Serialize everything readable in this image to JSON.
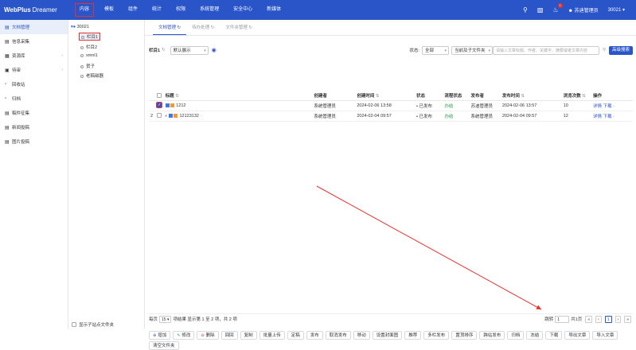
{
  "topbar": {
    "logo": "WebPlus",
    "logo_sub": "Dreamer",
    "nav": [
      "内容",
      "模板",
      "组件",
      "统计",
      "权限",
      "系统管理",
      "安全中心",
      "新媒体"
    ],
    "badge_count": "1",
    "user": "苏迪管理员",
    "site": "30021",
    "colors": {
      "bar": "#2a55c9",
      "highlight": "#e8312c"
    }
  },
  "sidebar": {
    "items": [
      {
        "label": "文档管理",
        "icon": "document-icon"
      },
      {
        "label": "信息采集",
        "icon": "collect-icon"
      },
      {
        "label": "资源库",
        "icon": "database-icon"
      },
      {
        "label": "待审",
        "icon": "review-icon"
      },
      {
        "label": "回收站",
        "icon": "trash-icon"
      },
      {
        "label": "归档",
        "icon": "archive-icon"
      },
      {
        "label": "稿件征集",
        "icon": "manuscript-icon"
      },
      {
        "label": "新闻投稿",
        "icon": "news-icon"
      },
      {
        "label": "图片投稿",
        "icon": "image-icon"
      }
    ]
  },
  "tree": {
    "root": "30021",
    "nodes": [
      "栏目1",
      "栏目2",
      "xmnl1",
      "贺子",
      "老稿磁器"
    ],
    "footer": "显示子站点文件夹"
  },
  "tabs": [
    "文档管理",
    "待办处理",
    "文件夹管理"
  ],
  "filter": {
    "column": "栏目1",
    "view": "默认展示",
    "status_label": "状态:",
    "status": "全部",
    "scope": "当前及子文件夹",
    "search_placeholder": "请输入文章标题、作者、关键字、摘要或者文章内容",
    "advanced": "高级搜索"
  },
  "table": {
    "headers": [
      "标题",
      "创建者",
      "创建时间",
      "状态",
      "流程状态",
      "发布者",
      "发布时间",
      "浏览次数",
      "操作"
    ],
    "rows": [
      {
        "no": "",
        "title": "1212",
        "creator": "系统管理员",
        "created": "2024-02-06 13:58",
        "status": "• 已发布",
        "flow": "办结",
        "publisher": "苏迪管理员",
        "published": "2024-02-06 13:57",
        "views": "10",
        "op1": "详情",
        "op2": "下载"
      },
      {
        "no": "2",
        "title": "12123132",
        "creator": "系统管理员",
        "created": "2024-02-04 09:57",
        "status": "• 已发布",
        "flow": "办结",
        "publisher": "系统管理员",
        "published": "2024-02-04 09:57",
        "views": "12",
        "op1": "详情",
        "op2": "下载"
      }
    ]
  },
  "pager": {
    "per_page_label": "每页",
    "per_page": "15",
    "summary": "项结果 显示第 1 至 2 项，共 2 项",
    "jump_label": "跳转",
    "jump_value": "1",
    "total_pages": "共1页",
    "current": "1"
  },
  "actions": [
    "增加",
    "修改",
    "删除",
    "回回",
    "复制",
    "批量上传",
    "定稿",
    "发布",
    "取消发布",
    "移动",
    "设置封面图",
    "推荐",
    "多栏发布",
    "置顶排序",
    "跨站发布",
    "归档",
    "冻结",
    "下载",
    "导出文章",
    "导入文章",
    "清空文件夹"
  ]
}
